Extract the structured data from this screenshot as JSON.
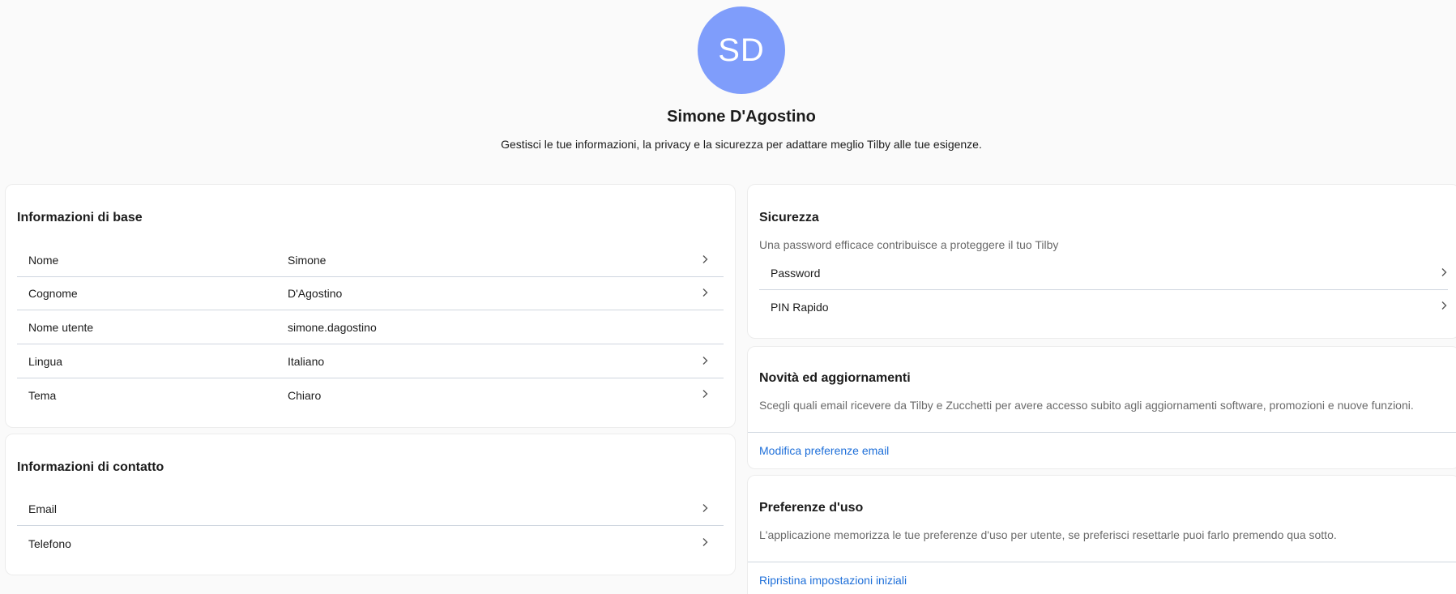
{
  "profile": {
    "initials": "SD",
    "avatar_color": "#7f9dfb",
    "name": "Simone D'Agostino",
    "subtitle": "Gestisci le tue informazioni, la privacy e la sicurezza per adattare meglio Tilby alle tue esigenze."
  },
  "basic_info": {
    "title": "Informazioni di base",
    "rows": [
      {
        "label": "Nome",
        "value": "Simone"
      },
      {
        "label": "Cognome",
        "value": "D'Agostino"
      },
      {
        "label": "Nome utente",
        "value": "simone.dagostino"
      },
      {
        "label": "Lingua",
        "value": "Italiano"
      },
      {
        "label": "Tema",
        "value": "Chiaro"
      }
    ]
  },
  "contact_info": {
    "title": "Informazioni di contatto",
    "rows": [
      {
        "label": "Email"
      },
      {
        "label": "Telefono"
      }
    ]
  },
  "security": {
    "title": "Sicurezza",
    "description": "Una password efficace contribuisce a proteggere il tuo Tilby",
    "rows": [
      {
        "label": "Password"
      },
      {
        "label": "PIN Rapido"
      }
    ]
  },
  "news": {
    "title": "Novità ed aggiornamenti",
    "description": "Scegli quali email ricevere da Tilby e Zucchetti per avere accesso subito agli aggiornamenti software, promozioni e nuove funzioni.",
    "link": "Modifica preferenze email"
  },
  "usage_prefs": {
    "title": "Preferenze d'uso",
    "description": "L'applicazione memorizza le tue preferenze d'uso per utente, se preferisci resettarle puoi farlo premendo qua sotto.",
    "link": "Ripristina impostazioni iniziali"
  },
  "icons": {
    "row_chevron": "chevron-right-icon"
  },
  "colors": {
    "link": "#1e6fd9",
    "background": "#fafafa"
  }
}
